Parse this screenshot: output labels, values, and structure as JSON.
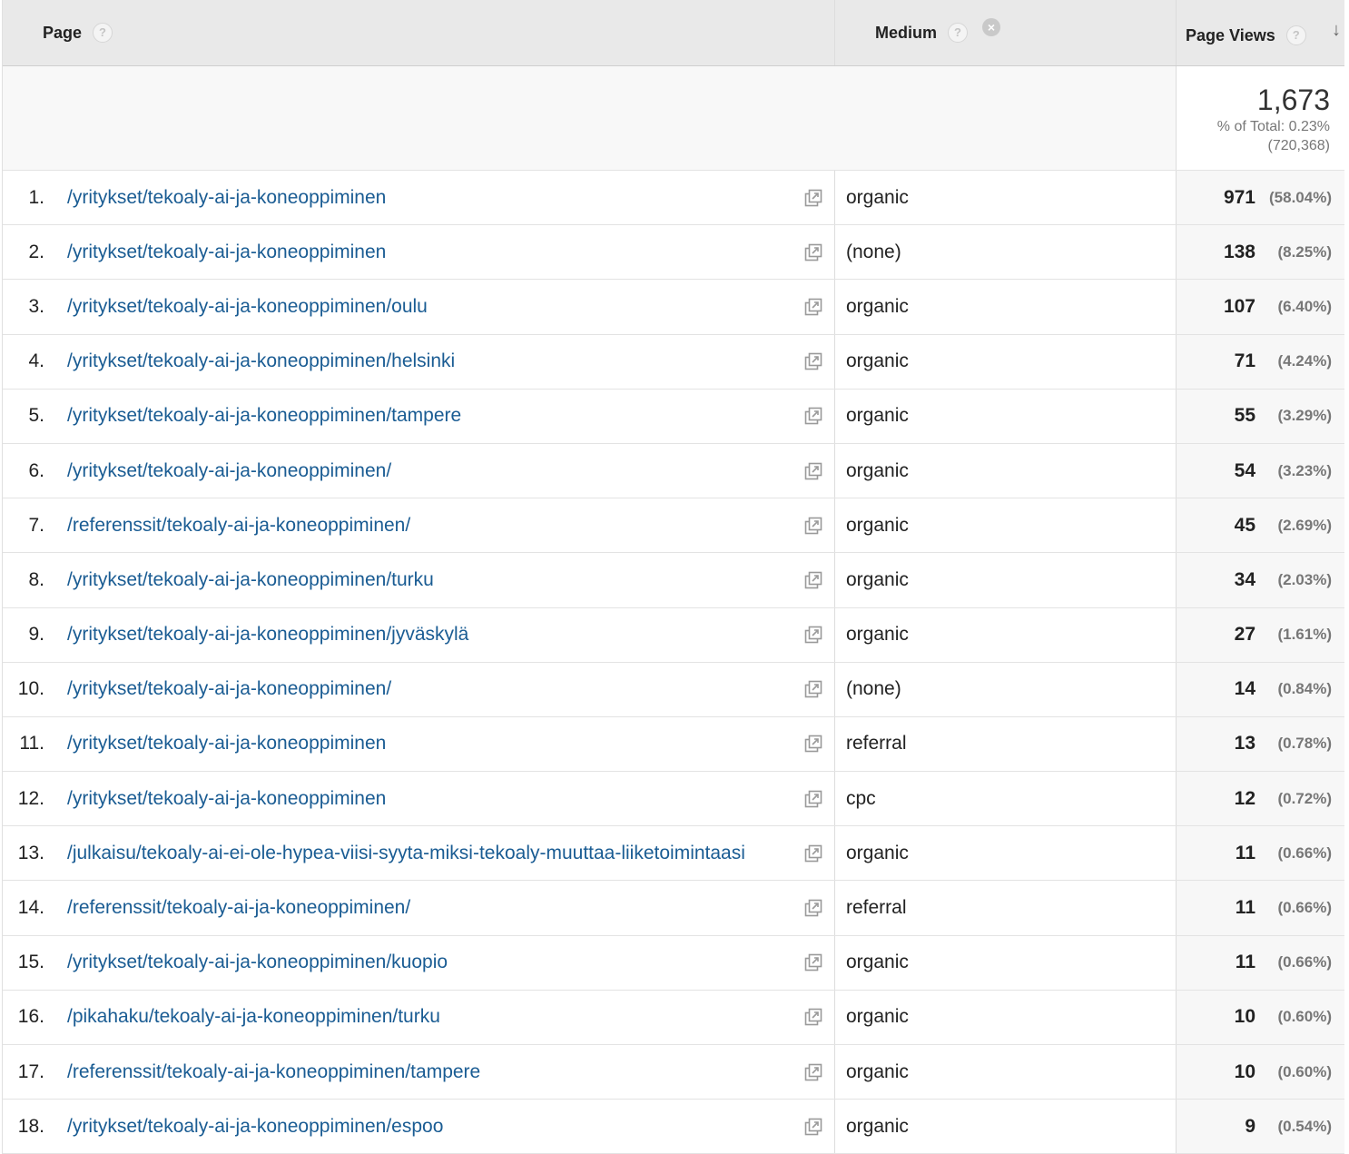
{
  "header": {
    "page_label": "Page",
    "medium_label": "Medium",
    "pageviews_label": "Page Views",
    "help_glyph": "?",
    "remove_glyph": "×",
    "sort_glyph": "↓"
  },
  "totals": {
    "value": "1,673",
    "percent_line": "% of Total: 0.23%",
    "overall": "(720,368)"
  },
  "rows": [
    {
      "index": "1.",
      "page": "/yritykset/tekoaly-ai-ja-koneoppiminen",
      "medium": "organic",
      "views": "971",
      "pct": "(58.04%)"
    },
    {
      "index": "2.",
      "page": "/yritykset/tekoaly-ai-ja-koneoppiminen",
      "medium": "(none)",
      "views": "138",
      "pct": "(8.25%)"
    },
    {
      "index": "3.",
      "page": "/yritykset/tekoaly-ai-ja-koneoppiminen/oulu",
      "medium": "organic",
      "views": "107",
      "pct": "(6.40%)"
    },
    {
      "index": "4.",
      "page": "/yritykset/tekoaly-ai-ja-koneoppiminen/helsinki",
      "medium": "organic",
      "views": "71",
      "pct": "(4.24%)"
    },
    {
      "index": "5.",
      "page": "/yritykset/tekoaly-ai-ja-koneoppiminen/tampere",
      "medium": "organic",
      "views": "55",
      "pct": "(3.29%)"
    },
    {
      "index": "6.",
      "page": "/yritykset/tekoaly-ai-ja-koneoppiminen/",
      "medium": "organic",
      "views": "54",
      "pct": "(3.23%)"
    },
    {
      "index": "7.",
      "page": "/referenssit/tekoaly-ai-ja-koneoppiminen/",
      "medium": "organic",
      "views": "45",
      "pct": "(2.69%)"
    },
    {
      "index": "8.",
      "page": "/yritykset/tekoaly-ai-ja-koneoppiminen/turku",
      "medium": "organic",
      "views": "34",
      "pct": "(2.03%)"
    },
    {
      "index": "9.",
      "page": "/yritykset/tekoaly-ai-ja-koneoppiminen/jyväskylä",
      "medium": "organic",
      "views": "27",
      "pct": "(1.61%)"
    },
    {
      "index": "10.",
      "page": "/yritykset/tekoaly-ai-ja-koneoppiminen/",
      "medium": "(none)",
      "views": "14",
      "pct": "(0.84%)"
    },
    {
      "index": "11.",
      "page": "/yritykset/tekoaly-ai-ja-koneoppiminen",
      "medium": "referral",
      "views": "13",
      "pct": "(0.78%)"
    },
    {
      "index": "12.",
      "page": "/yritykset/tekoaly-ai-ja-koneoppiminen",
      "medium": "cpc",
      "views": "12",
      "pct": "(0.72%)"
    },
    {
      "index": "13.",
      "page": "/julkaisu/tekoaly-ai-ei-ole-hypea-viisi-syyta-miksi-tekoaly-muuttaa-liiketoimintaasi",
      "medium": "organic",
      "views": "11",
      "pct": "(0.66%)"
    },
    {
      "index": "14.",
      "page": "/referenssit/tekoaly-ai-ja-koneoppiminen/",
      "medium": "referral",
      "views": "11",
      "pct": "(0.66%)"
    },
    {
      "index": "15.",
      "page": "/yritykset/tekoaly-ai-ja-koneoppiminen/kuopio",
      "medium": "organic",
      "views": "11",
      "pct": "(0.66%)"
    },
    {
      "index": "16.",
      "page": "/pikahaku/tekoaly-ai-ja-koneoppiminen/turku",
      "medium": "organic",
      "views": "10",
      "pct": "(0.60%)"
    },
    {
      "index": "17.",
      "page": "/referenssit/tekoaly-ai-ja-koneoppiminen/tampere",
      "medium": "organic",
      "views": "10",
      "pct": "(0.60%)"
    },
    {
      "index": "18.",
      "page": "/yritykset/tekoaly-ai-ja-koneoppiminen/espoo",
      "medium": "organic",
      "views": "9",
      "pct": "(0.54%)"
    }
  ],
  "icons": {
    "external": "external-link-icon"
  },
  "colors": {
    "link": "#1a5c93",
    "header_bg": "#e9e9e9"
  }
}
